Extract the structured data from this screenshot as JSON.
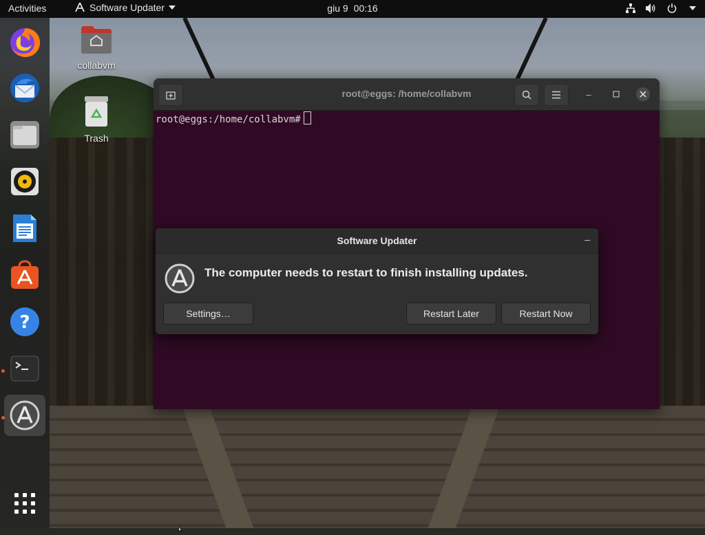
{
  "topbar": {
    "activities": "Activities",
    "app_name": "Software Updater",
    "date": "giu 9",
    "time": "00:16"
  },
  "dock": {
    "items": [
      {
        "name": "firefox",
        "icon": "firefox-icon",
        "running": false,
        "active": false
      },
      {
        "name": "thunderbird",
        "icon": "thunderbird-icon",
        "running": false,
        "active": false
      },
      {
        "name": "files",
        "icon": "files-icon",
        "running": false,
        "active": false
      },
      {
        "name": "rhythmbox",
        "icon": "rhythmbox-icon",
        "running": false,
        "active": false
      },
      {
        "name": "libreoffice-writer",
        "icon": "writer-icon",
        "running": false,
        "active": false
      },
      {
        "name": "ubuntu-software",
        "icon": "software-icon",
        "running": false,
        "active": false
      },
      {
        "name": "help",
        "icon": "help-icon",
        "running": false,
        "active": false
      },
      {
        "name": "terminal",
        "icon": "terminal-icon",
        "running": true,
        "active": false
      },
      {
        "name": "software-updater",
        "icon": "updater-icon",
        "running": true,
        "active": true
      }
    ],
    "show_apps_icon": "app-grid-icon"
  },
  "desktop": {
    "icons": [
      {
        "label": "collabvm",
        "icon": "home-folder-icon"
      },
      {
        "label": "Trash",
        "icon": "trash-icon"
      }
    ]
  },
  "terminal": {
    "title": "root@eggs: /home/collabvm",
    "prompt": "root@eggs:/home/collabvm#",
    "background": "#300a24"
  },
  "dialog": {
    "title": "Software Updater",
    "message": "The computer needs to restart to finish installing updates.",
    "buttons": {
      "settings": "Settings…",
      "restart_later": "Restart Later",
      "restart_now": "Restart Now"
    }
  },
  "colors": {
    "accent": "#e95420",
    "panel": "#0e0e0e",
    "dialog_bg": "#303030"
  }
}
